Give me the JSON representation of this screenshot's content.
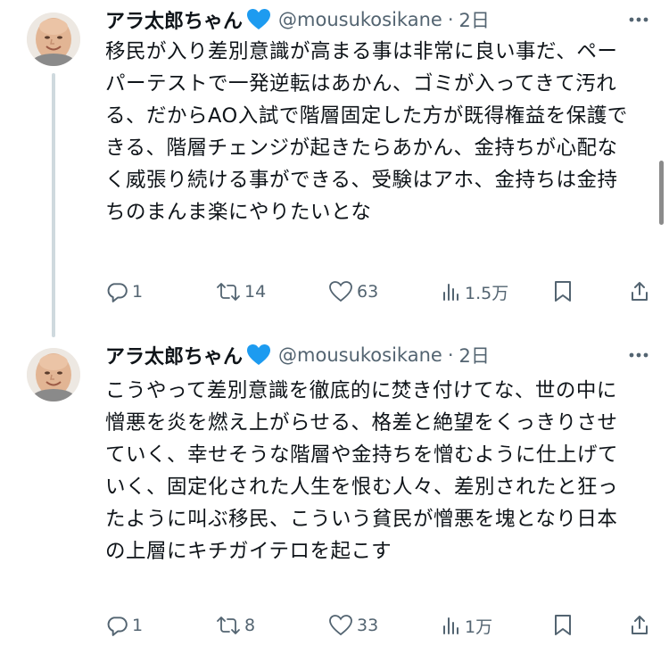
{
  "theme": {
    "text": "#0f1419",
    "muted": "#536471",
    "verified_blue": "#1d9bf0",
    "thread_line": "#cfd9de"
  },
  "tweets": [
    {
      "author": {
        "name": "アラ太郎ちゃん",
        "handle": "@mousukosikane",
        "badge_icon": "blue-heart-emoji"
      },
      "separator": "·",
      "time": "2日",
      "text": "移民が入り差別意識が高まる事は非常に良い事だ、ペーパーテストで一発逆転はあかん、ゴミが入ってきて汚れる、だからAO入試で階層固定した方が既得権益を保護できる、階層チェンジが起きたらあかん、金持ちが心配なく威張り続ける事ができる、受験はアホ、金持ちは金持ちのまんま楽にやりたいとな",
      "stats": {
        "replies": "1",
        "reposts": "14",
        "likes": "63",
        "views": "1.5万"
      }
    },
    {
      "author": {
        "name": "アラ太郎ちゃん",
        "handle": "@mousukosikane",
        "badge_icon": "blue-heart-emoji"
      },
      "separator": "·",
      "time": "2日",
      "text": "こうやって差別意識を徹底的に焚き付けてな、世の中に憎悪を炎を燃え上がらせる、格差と絶望をくっきりさせていく、幸せそうな階層や金持ちを憎むように仕上げていく、固定化された人生を恨む人々、差別されたと狂ったように叫ぶ移民、こういう貧民が憎悪を塊となり日本の上層にキチガイテロを起こす",
      "stats": {
        "replies": "1",
        "reposts": "8",
        "likes": "33",
        "views": "1万"
      }
    }
  ]
}
